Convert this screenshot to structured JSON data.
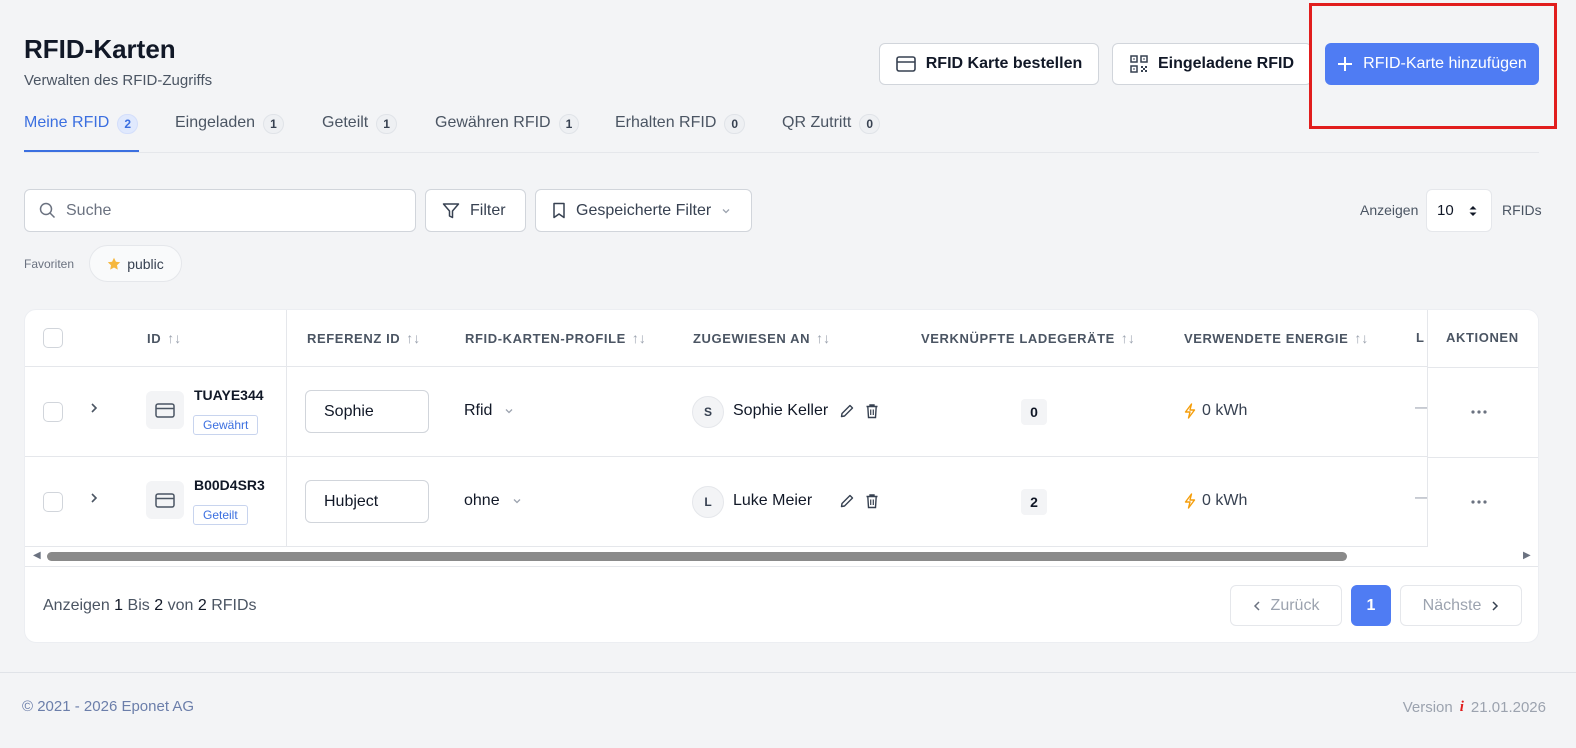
{
  "header": {
    "title": "RFID-Karten",
    "subtitle": "Verwalten des RFID-Zugriffs",
    "order_label": "RFID Karte bestellen",
    "invited_label": "Eingeladene RFID",
    "add_label": "RFID-Karte hinzufügen"
  },
  "tabs": [
    {
      "label": "Meine RFID",
      "count": "2"
    },
    {
      "label": "Eingeladen",
      "count": "1"
    },
    {
      "label": "Geteilt",
      "count": "1"
    },
    {
      "label": "Gewähren RFID",
      "count": "1"
    },
    {
      "label": "Erhalten RFID",
      "count": "0"
    },
    {
      "label": "QR Zutritt",
      "count": "0"
    }
  ],
  "toolbar": {
    "search_placeholder": "Suche",
    "filter_label": "Filter",
    "saved_filter_label": "Gespeicherte Filter",
    "show_label": "Anzeigen",
    "page_size": "10",
    "unit_label": "RFIDs",
    "favorites_label": "Favoriten",
    "favorite_chip": "public"
  },
  "table": {
    "columns": {
      "id": "ID",
      "reference": "REFERENZ ID",
      "profiles": "RFID-KARTEN-PROFILE",
      "assigned": "ZUGEWIESEN AN",
      "chargers": "VERKNÜPFTE LADEGERÄTE",
      "energy": "VERWENDETE ENERGIE",
      "truncated": "L",
      "actions": "AKTIONEN"
    },
    "rows": [
      {
        "id": "TUAYE344",
        "badge": "Gewährt",
        "reference": "Sophie",
        "profile": "Rfid",
        "avatar": "S",
        "assignee": "Sophie Keller",
        "chargers": "0",
        "energy": "0 kWh",
        "dash": "—"
      },
      {
        "id": "B00D4SR3",
        "badge": "Geteilt",
        "reference": "Hubject",
        "profile": "ohne",
        "avatar": "L",
        "assignee": "Luke Meier",
        "chargers": "2",
        "energy": "0 kWh",
        "dash": "—"
      }
    ]
  },
  "pagination": {
    "prefix": "Anzeigen",
    "from": "1",
    "mid": "Bis",
    "to": "2",
    "of": "von",
    "total": "2",
    "unit": "RFIDs",
    "prev_label": "Zurück",
    "current_page": "1",
    "next_label": "Nächste"
  },
  "footer": {
    "copyright": "© 2021 - 2026 Eponet AG",
    "version_label": "Version",
    "version_info": "i",
    "version_date": "21.01.2026"
  },
  "colors": {
    "primary": "#4f7cf3",
    "active_tab": "#3b6fe0",
    "highlight": "#e11d1d",
    "energy_bolt": "#f59e0b",
    "star": "#f6b73c"
  }
}
